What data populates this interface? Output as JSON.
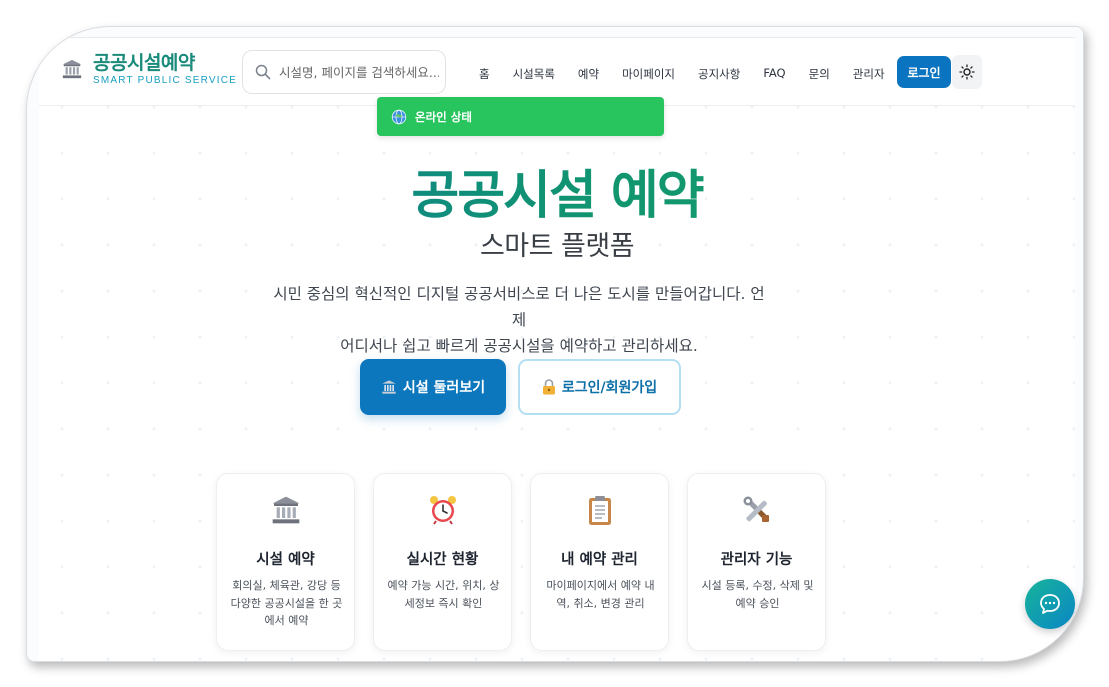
{
  "header": {
    "brand_title": "공공시설예약",
    "brand_subtitle": "SMART PUBLIC SERVICE",
    "search_placeholder": "시설명, 페이지를 검색하세요...",
    "nav": [
      "홈",
      "시설목록",
      "예약",
      "마이페이지",
      "공지사항",
      "FAQ",
      "문의",
      "관리자"
    ],
    "login_label": "로그인"
  },
  "toast": {
    "text": "온라인 상태"
  },
  "hero": {
    "title": "공공시설 예약",
    "subtitle": "스마트 플랫폼",
    "desc_line1": "시민 중심의 혁신적인 디지털 공공서비스로 더 나은 도시를 만들어갑니다. 언제",
    "desc_line2": "어디서나 쉽고 빠르게 공공시설을 예약하고 관리하세요.",
    "primary_button": "시설 둘러보기",
    "secondary_button": "로그인/회원가입"
  },
  "features": [
    {
      "icon": "classical-building-icon",
      "title": "시설 예약",
      "desc": "회의실, 체육관, 강당 등 다양한 공공시설을 한 곳에서 예약"
    },
    {
      "icon": "alarm-clock-icon",
      "title": "실시간 현황",
      "desc": "예약 가능 시간, 위치, 상세정보 즉시 확인"
    },
    {
      "icon": "clipboard-icon",
      "title": "내 예약 관리",
      "desc": "마이페이지에서 예약 내역, 취소, 변경 관리"
    },
    {
      "icon": "tools-icon",
      "title": "관리자 기능",
      "desc": "시설 등록, 수정, 삭제 및 예약 승인"
    }
  ],
  "colors": {
    "primary": "#0c77bd",
    "brand": "#1a8a7a",
    "online": "#28c55e"
  }
}
